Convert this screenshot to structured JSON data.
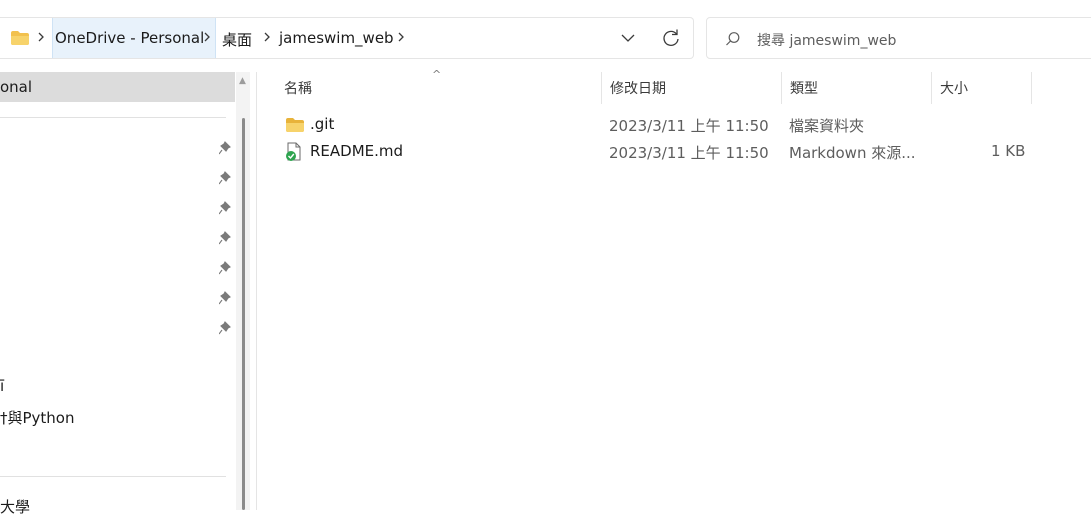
{
  "breadcrumb": {
    "items": [
      "OneDrive - Personal",
      "桌面",
      "jameswim_web"
    ]
  },
  "search": {
    "placeholder": "搜尋 jameswim_web"
  },
  "nav": {
    "selected": "onal",
    "items_partial": [
      "ī",
      "†與Python",
      "大學"
    ]
  },
  "columns": {
    "name": "名稱",
    "modified": "修改日期",
    "type": "類型",
    "size": "大小"
  },
  "files": [
    {
      "name": ".git",
      "modified": "2023/3/11 上午 11:50",
      "type": "檔案資料夾",
      "size": "",
      "icon": "folder-icon"
    },
    {
      "name": "README.md",
      "modified": "2023/3/11 上午 11:50",
      "type": "Markdown 來源...",
      "size": "1 KB",
      "icon": "markdown-file-synced-icon"
    }
  ],
  "colors": {
    "folder": "#f2c14e",
    "sync_green": "#2ea44f",
    "selected_bg": "#dcdcdc",
    "hover_bg": "#e8f2fb"
  }
}
